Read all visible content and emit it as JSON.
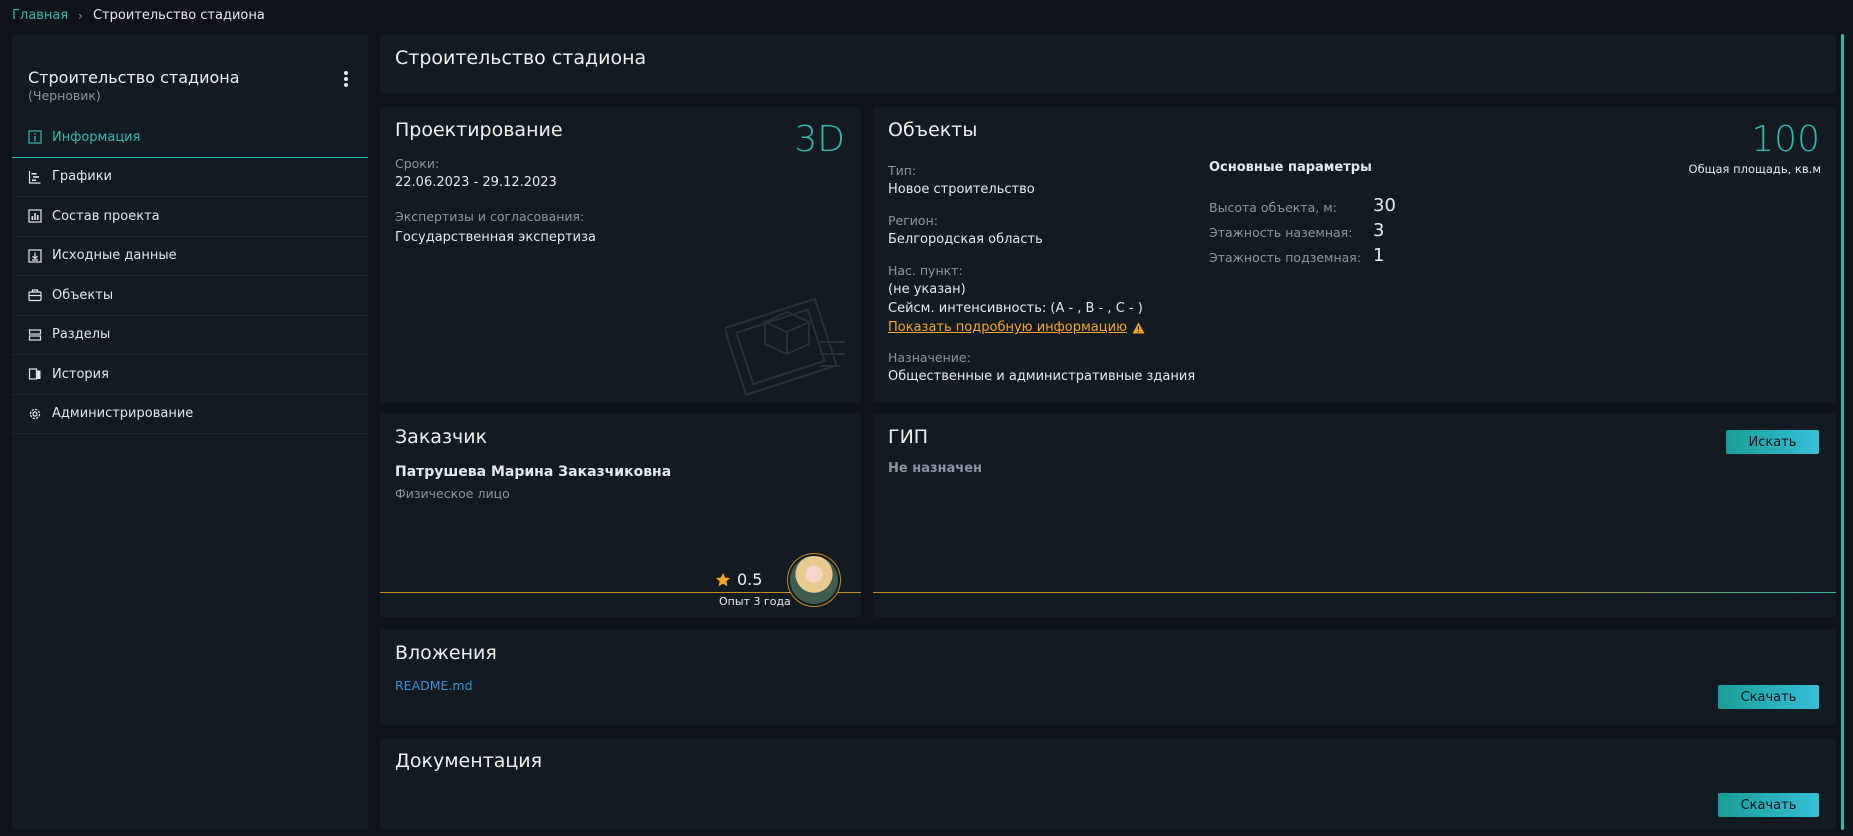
{
  "breadcrumb": {
    "home": "Главная",
    "current": "Строительство стадиона"
  },
  "sidebar": {
    "title": "Строительство стадиона",
    "status": "(Черновик)",
    "items": [
      {
        "label": "Информация",
        "icon": "info-icon",
        "active": true
      },
      {
        "label": "Графики",
        "icon": "gantt-icon"
      },
      {
        "label": "Состав проекта",
        "icon": "chart-icon"
      },
      {
        "label": "Исходные данные",
        "icon": "download-icon"
      },
      {
        "label": "Объекты",
        "icon": "briefcase-icon"
      },
      {
        "label": "Разделы",
        "icon": "sections-icon"
      },
      {
        "label": "История",
        "icon": "history-icon"
      },
      {
        "label": "Администрирование",
        "icon": "gear-icon"
      }
    ]
  },
  "header": {
    "title": "Строительство стадиона"
  },
  "design": {
    "title": "Проектирование",
    "badge": "3D",
    "terms_label": "Сроки:",
    "terms_value": "22.06.2023 - 29.12.2023",
    "expertise_label": "Экспертизы и согласования:",
    "expertise_value": "Государственная экспертиза"
  },
  "objects": {
    "title": "Объекты",
    "type_label": "Тип:",
    "type_value": "Новое строительство",
    "region_label": "Регион:",
    "region_value": "Белгородская область",
    "locality_label": "Нас. пункт:",
    "locality_value": "(не указан)",
    "seismic": "Сейсм. интенсивность: (A - , B - , C - )",
    "details_link": "Показать подробную информацию",
    "purpose_label": "Назначение:",
    "purpose_value": "Общественные и административные здания",
    "params_title": "Основные параметры",
    "params": [
      {
        "label": "Высота объекта, м:",
        "value": "30"
      },
      {
        "label": "Этажность наземная:",
        "value": "3"
      },
      {
        "label": "Этажность подземная:",
        "value": "1"
      }
    ],
    "area_value": "100",
    "area_label": "Общая площадь, кв.м"
  },
  "customer": {
    "title": "Заказчик",
    "name": "Патрушева Марина Заказчиковна",
    "type": "Физическое лицо",
    "rating": "0.5",
    "experience": "Опыт 3 года"
  },
  "gip": {
    "title": "ГИП",
    "status": "Не назначен",
    "search_button": "Искать"
  },
  "attachments": {
    "title": "Вложения",
    "file": "README.md",
    "download_button": "Скачать"
  },
  "documentation": {
    "title": "Документация",
    "download_button": "Скачать"
  },
  "colors": {
    "accent": "#2fb8ac",
    "warning": "#f5a623",
    "background": "#0d1319",
    "card": "#131b22"
  }
}
